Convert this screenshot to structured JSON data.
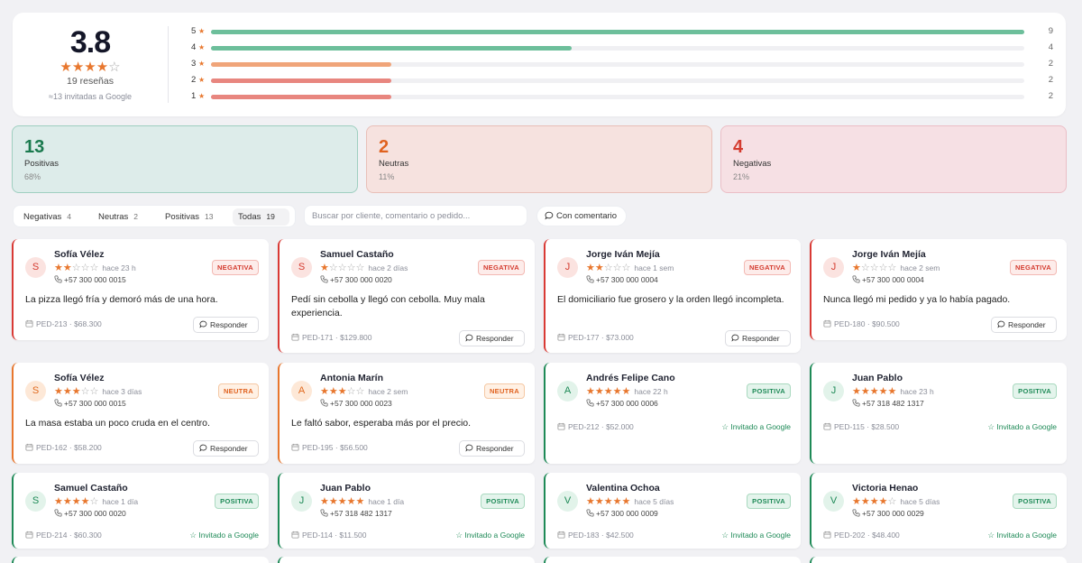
{
  "summary": {
    "score": "3.8",
    "stars": {
      "full": 4,
      "empty": 1
    },
    "reviews_label": "19 reseñas",
    "invited_label": "≈13 invitadas a Google",
    "bars": [
      {
        "label": "5",
        "count": "9",
        "fraction": 1.0,
        "color": "#6dbf9b"
      },
      {
        "label": "4",
        "count": "4",
        "fraction": 0.444,
        "color": "#6dbf9b"
      },
      {
        "label": "3",
        "count": "2",
        "fraction": 0.222,
        "color": "#f0a57a"
      },
      {
        "label": "2",
        "count": "2",
        "fraction": 0.222,
        "color": "#e8867f"
      },
      {
        "label": "1",
        "count": "2",
        "fraction": 0.222,
        "color": "#e8867f"
      }
    ]
  },
  "stats": {
    "positive": {
      "count": "13",
      "label": "Positivas",
      "pct": "68%"
    },
    "neutral": {
      "count": "2",
      "label": "Neutras",
      "pct": "11%"
    },
    "negative": {
      "count": "4",
      "label": "Negativas",
      "pct": "21%"
    }
  },
  "filters": {
    "tabs": [
      {
        "label": "Negativas",
        "count": "4"
      },
      {
        "label": "Neutras",
        "count": "2"
      },
      {
        "label": "Positivas",
        "count": "13"
      },
      {
        "label": "Todas",
        "count": "19"
      }
    ],
    "active": "Todas",
    "search_placeholder": "Buscar por cliente, comentario o pedido...",
    "comment_chip": "Con comentario"
  },
  "labels": {
    "reply": "Responder",
    "google": "Invitado a Google"
  },
  "reviews": [
    {
      "tone": "neg",
      "initial": "S",
      "name": "Sofía Vélez",
      "stars": 2,
      "time": "hace 23 h",
      "phone": "+57 300 000 0015",
      "badge": "NEGATIVA",
      "text": "La pizza llegó fría y demoró más de una hora.",
      "order": "PED-213",
      "amount": "$68.300",
      "action": "reply"
    },
    {
      "tone": "neg",
      "initial": "S",
      "name": "Samuel Castaño",
      "stars": 1,
      "time": "hace 2 días",
      "phone": "+57 300 000 0020",
      "badge": "NEGATIVA",
      "text": "Pedí sin cebolla y llegó con cebolla. Muy mala experiencia.",
      "order": "PED-171",
      "amount": "$129.800",
      "action": "reply"
    },
    {
      "tone": "neg",
      "initial": "J",
      "name": "Jorge Iván Mejía",
      "stars": 2,
      "time": "hace 1 sem",
      "phone": "+57 300 000 0004",
      "badge": "NEGATIVA",
      "text": "El domiciliario fue grosero y la orden llegó incompleta.",
      "order": "PED-177",
      "amount": "$73.000",
      "action": "reply"
    },
    {
      "tone": "neg",
      "initial": "J",
      "name": "Jorge Iván Mejía",
      "stars": 1,
      "time": "hace 2 sem",
      "phone": "+57 300 000 0004",
      "badge": "NEGATIVA",
      "text": "Nunca llegó mi pedido y ya lo había pagado.",
      "order": "PED-180",
      "amount": "$90.500",
      "action": "reply"
    },
    {
      "tone": "neu",
      "initial": "S",
      "name": "Sofía Vélez",
      "stars": 3,
      "time": "hace 3 días",
      "phone": "+57 300 000 0015",
      "badge": "NEUTRA",
      "text": "La masa estaba un poco cruda en el centro.",
      "order": "PED-162",
      "amount": "$58.200",
      "action": "reply"
    },
    {
      "tone": "neu",
      "initial": "A",
      "name": "Antonia Marín",
      "stars": 3,
      "time": "hace 2 sem",
      "phone": "+57 300 000 0023",
      "badge": "NEUTRA",
      "text": "Le faltó sabor, esperaba más por el precio.",
      "order": "PED-195",
      "amount": "$56.500",
      "action": "reply"
    },
    {
      "tone": "pos",
      "initial": "A",
      "name": "Andrés Felipe Cano",
      "stars": 5,
      "time": "hace 22 h",
      "phone": "+57 300 000 0006",
      "badge": "POSITIVA",
      "text": "",
      "order": "PED-212",
      "amount": "$52.000",
      "action": "google"
    },
    {
      "tone": "pos",
      "initial": "J",
      "name": "Juan Pablo",
      "stars": 5,
      "time": "hace 23 h",
      "phone": "+57 318 482 1317",
      "badge": "POSITIVA",
      "text": "",
      "order": "PED-115",
      "amount": "$28.500",
      "action": "google"
    },
    {
      "tone": "pos",
      "initial": "S",
      "name": "Samuel Castaño",
      "stars": 4,
      "time": "hace 1 día",
      "phone": "+57 300 000 0020",
      "badge": "POSITIVA",
      "text": "",
      "order": "PED-214",
      "amount": "$60.300",
      "action": "google"
    },
    {
      "tone": "pos",
      "initial": "J",
      "name": "Juan Pablo",
      "stars": 5,
      "time": "hace 1 día",
      "phone": "+57 318 482 1317",
      "badge": "POSITIVA",
      "text": "",
      "order": "PED-114",
      "amount": "$11.500",
      "action": "google"
    },
    {
      "tone": "pos",
      "initial": "V",
      "name": "Valentina Ochoa",
      "stars": 5,
      "time": "hace 5 días",
      "phone": "+57 300 000 0009",
      "badge": "POSITIVA",
      "text": "",
      "order": "PED-183",
      "amount": "$42.500",
      "action": "google"
    },
    {
      "tone": "pos",
      "initial": "V",
      "name": "Victoria Henao",
      "stars": 4,
      "time": "hace 5 días",
      "phone": "+57 300 000 0029",
      "badge": "POSITIVA",
      "text": "",
      "order": "PED-202",
      "amount": "$48.400",
      "action": "google"
    }
  ],
  "colors": {
    "accent_orange": "#e8772e",
    "positive": "#1e8a57",
    "negative": "#d43b2f"
  }
}
